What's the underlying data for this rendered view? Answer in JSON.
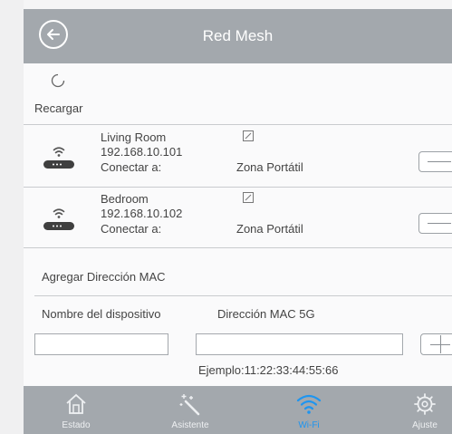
{
  "header": {
    "title": "Red Mesh",
    "back_icon": "back-arrow-icon"
  },
  "reload": {
    "label": "Recargar",
    "icon": "reload-icon"
  },
  "devices": [
    {
      "name": "Living Room",
      "ip": "192.168.10.101",
      "connect_label": "Conectar a:",
      "connect_value": "Zona Portátil"
    },
    {
      "name": "Bedroom",
      "ip": "192.168.10.102",
      "connect_label": "Conectar a:",
      "connect_value": "Zona Portátil"
    }
  ],
  "add_mac": {
    "title": "Agregar Dirección MAC",
    "col_device_name": "Nombre del dispositivo",
    "col_mac": "Dirección MAC 5G",
    "device_name_value": "",
    "mac_value": "",
    "example": "Ejemplo:11:22:33:44:55:66"
  },
  "nav": {
    "items": [
      {
        "label": "Estado",
        "icon": "house-icon",
        "active": false
      },
      {
        "label": "Asistente",
        "icon": "magic-wand-icon",
        "active": false
      },
      {
        "label": "Wi-Fi",
        "icon": "wifi-icon",
        "active": true
      },
      {
        "label": "Ajuste",
        "icon": "gear-icon",
        "active": false
      }
    ]
  },
  "colors": {
    "header_bg": "#a3a8ad",
    "active_tab": "#1e95f0",
    "divider": "#c9cbce"
  }
}
